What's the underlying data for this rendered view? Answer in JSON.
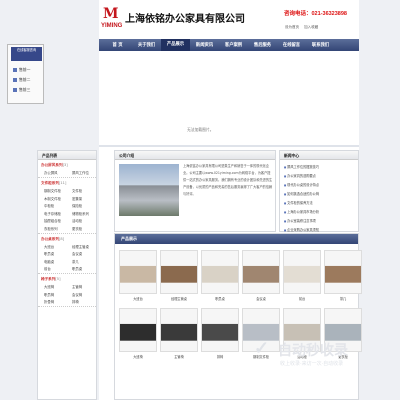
{
  "header": {
    "logo_initials": "M",
    "logo_name": "YIMING",
    "company": "上海依铭办公家具有限公司",
    "phone": "咨询电话：021-36323898",
    "toplinks": [
      "设为首页",
      "加入收藏"
    ]
  },
  "nav": [
    "首 页",
    "关于我们",
    "产品展示",
    "新闻资讯",
    "客户案例",
    "售后服务",
    "在线留言",
    "联系我们"
  ],
  "banner": {
    "note": "无法加载图片。"
  },
  "side_widget": {
    "heading": "在线客服咨询",
    "items": [
      "售前一",
      "售前二",
      "售前三"
    ]
  },
  "left": {
    "title": "产品列表",
    "categories": [
      {
        "name": "办公屏风系列",
        "count": "[3]",
        "subs": [
          "办公屏风",
          "屏风工作位"
        ]
      },
      {
        "name": "文件柜系列",
        "count": "[11]",
        "subs": [
          "钢制文件柜",
          "文件柜",
          "木制文件柜",
          "密集架",
          "中柜柜",
          "保险柜",
          "电子存储柜",
          "储物柜系列",
          "抽屉组合柜",
          "活动柜",
          "衣柜系列",
          "更衣柜"
        ]
      },
      {
        "name": "办公桌系列",
        "count": "[8]",
        "subs": [
          "大班台",
          "经理主管桌",
          "职员桌",
          "会议桌",
          "电脑桌",
          "茶几",
          "前台",
          "职员桌"
        ]
      },
      {
        "name": "椅子系列",
        "count": "[5]",
        "subs": [
          "大班椅",
          "主管椅",
          "职员椅",
          "会议椅",
          "折叠椅",
          "排椅"
        ]
      }
    ]
  },
  "about": {
    "title": "公司介绍",
    "text": "上海依铭办公家具有限公司是集生产和销售于一体的现代化企业。公司主要以www.021yiming.com为网络平台，为客户提供一站式的办公家具服务。我们拥有专业的设计团队和先进的生产设备，以优质的产品和完善的售后服务赢得了广大客户的信赖与好评。"
  },
  "news": {
    "title": "新闻中心",
    "items": [
      "屏风工作位的摆放技巧",
      "办公家具的选购要点",
      "现代办公桌的设计特点",
      "如何挑选合适的办公椅",
      "文件柜的保养方法",
      "上海办公家具市场分析",
      "办公室装修注意事项",
      "企业采购办公家具须知"
    ]
  },
  "products": {
    "title": "产品展示",
    "items": [
      "大班台",
      "经理主管桌",
      "职员桌",
      "会议桌",
      "前台",
      "茶几",
      "大班椅",
      "主管椅",
      "排椅",
      "钢制文件柜",
      "活动柜",
      "更衣柜"
    ]
  },
  "watermark": {
    "text": "自动秒收录",
    "sub": "收上收录·来访一次·自动收录"
  }
}
